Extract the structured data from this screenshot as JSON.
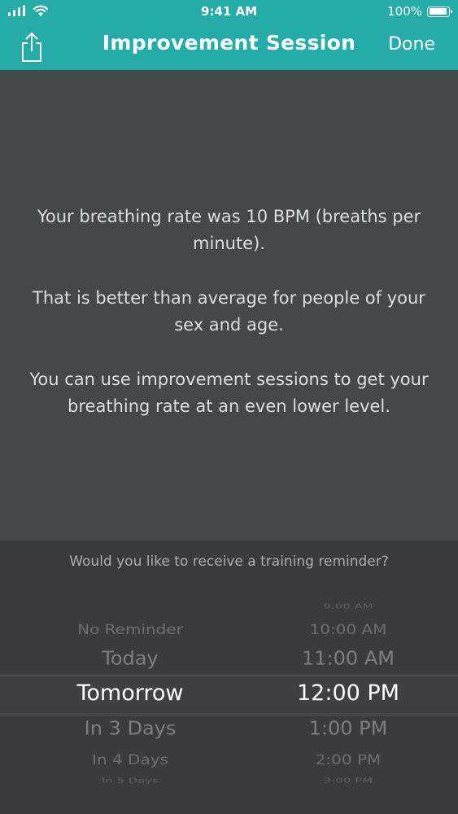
{
  "status_bar": {
    "time": "9:41 AM",
    "battery_percent": "100%",
    "battery_level": 1.0,
    "signal_bars": 4
  },
  "nav": {
    "title": "Improvement Session",
    "done_label": "Done",
    "share_icon": "share-icon"
  },
  "message": {
    "para1": "Your breathing rate was 10 BPM (breaths per minute).",
    "para2": "That is better than average for people of your sex and age.",
    "para3": "You can use improvement sessions to get your breathing rate at an even lower level."
  },
  "picker": {
    "question": "Would you like to receive a training reminder?",
    "reminder_options": [
      "No Reminder",
      "Today",
      "Tomorrow",
      "In 3 Days",
      "In 4 Days",
      "In 5 Days"
    ],
    "selected_reminder": "Tomorrow",
    "time_options": [
      "9:00 AM",
      "10:00 AM",
      "11:00 AM",
      "12:00 PM",
      "1:00 PM",
      "2:00 PM",
      "3:00 PM"
    ],
    "selected_time": "12:00 PM"
  },
  "colors": {
    "header": "#26aca8",
    "background": "#43484b",
    "picker_background": "#383c3f"
  }
}
